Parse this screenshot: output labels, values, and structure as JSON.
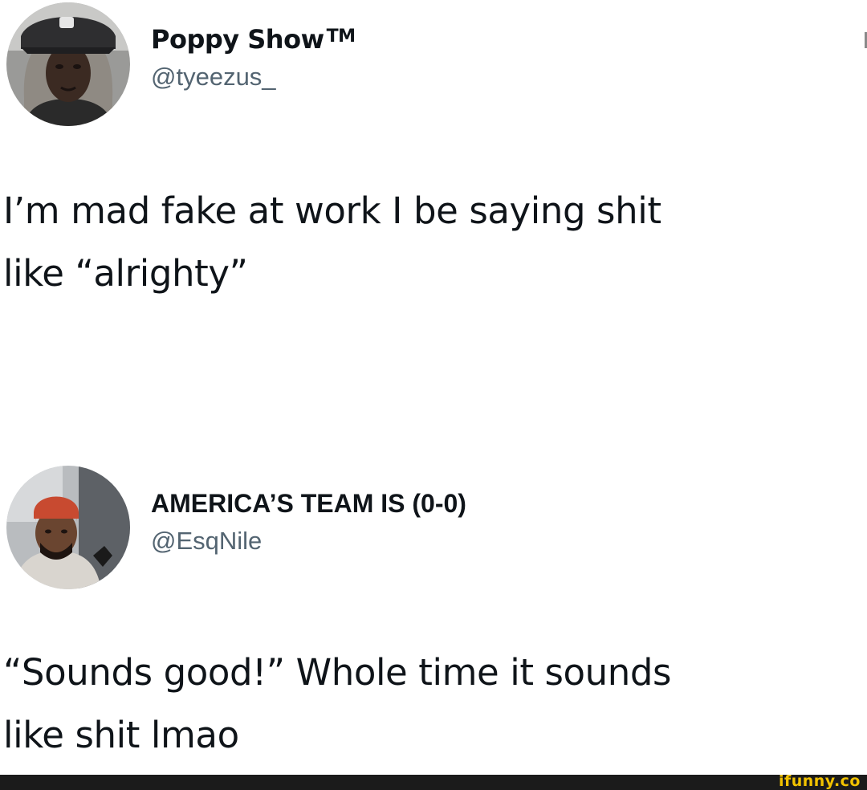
{
  "tweets": [
    {
      "display_name": "Poppy Show",
      "name_suffix": "TM",
      "handle": "@tyeezus_",
      "text_lines": [
        "I’m mad fake at work I be saying shit",
        "like “alrighty”"
      ]
    },
    {
      "display_name": "AMERICA’S TEAM IS (0-0)",
      "handle": "@EsqNile",
      "text_lines": [
        "“Sounds good!” Whole time it sounds",
        "like shit lmao"
      ]
    }
  ],
  "watermark": {
    "text": "ifunny.co",
    "color": "#f2c200"
  },
  "colors": {
    "text": "#0f1419",
    "handle": "#536471",
    "background": "#ffffff",
    "footer_bar": "#1b1b1b"
  }
}
